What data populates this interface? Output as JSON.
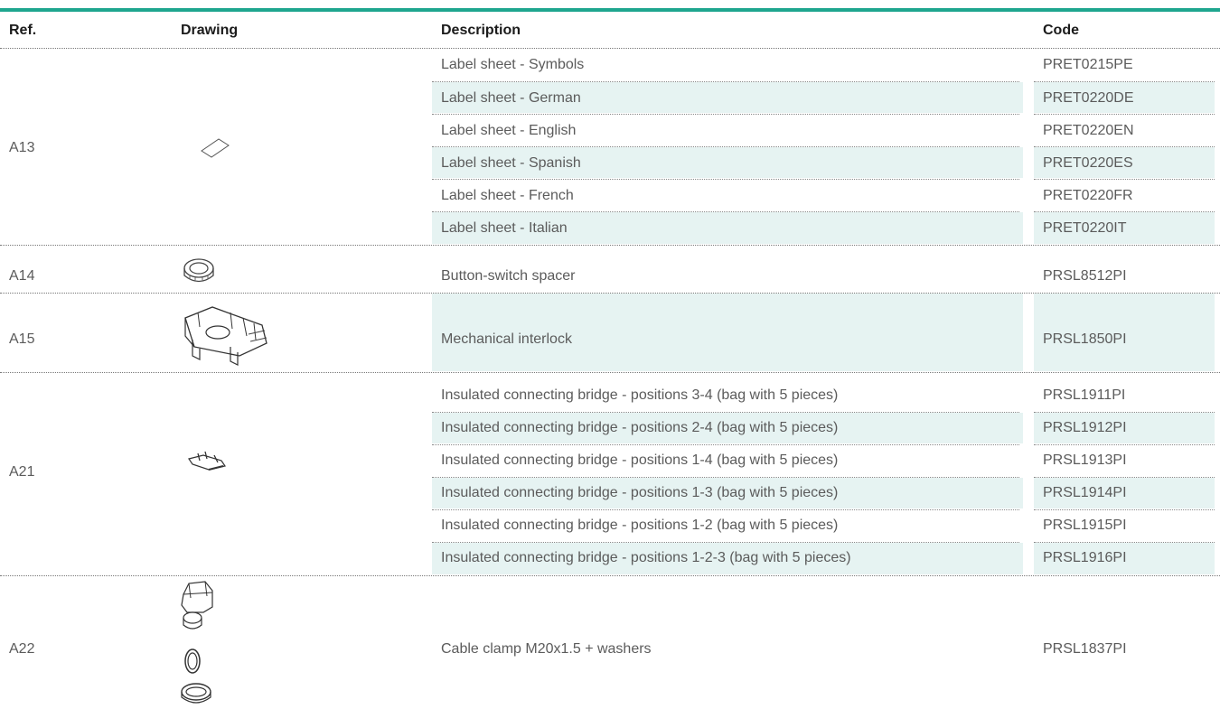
{
  "table": {
    "headers": [
      "Ref.",
      "Drawing",
      "Description",
      "Code"
    ],
    "groups": [
      {
        "ref": "A13",
        "drawing_icon": "label-sheet-icon",
        "rows": [
          {
            "description": "Label sheet - Symbols",
            "code": "PRET0215PE"
          },
          {
            "description": "Label sheet - German",
            "code": "PRET0220DE"
          },
          {
            "description": "Label sheet - English",
            "code": "PRET0220EN"
          },
          {
            "description": "Label sheet - Spanish",
            "code": "PRET0220ES"
          },
          {
            "description": "Label sheet - French",
            "code": "PRET0220FR"
          },
          {
            "description": "Label sheet - Italian",
            "code": "PRET0220IT"
          }
        ]
      },
      {
        "ref": "A14",
        "drawing_icon": "button-switch-spacer-icon",
        "rows": [
          {
            "description": "Button-switch spacer",
            "code": "PRSL8512PI"
          }
        ]
      },
      {
        "ref": "A15",
        "drawing_icon": "mechanical-interlock-icon",
        "rows": [
          {
            "description": "Mechanical interlock",
            "code": "PRSL1850PI"
          }
        ]
      },
      {
        "ref": "A21",
        "drawing_icon": "connecting-bridge-icon",
        "rows": [
          {
            "description": "Insulated connecting bridge - positions 3-4 (bag with 5 pieces)",
            "code": "PRSL1911PI"
          },
          {
            "description": "Insulated connecting bridge - positions 2-4 (bag with 5 pieces)",
            "code": "PRSL1912PI"
          },
          {
            "description": "Insulated connecting bridge - positions 1-4 (bag with 5 pieces)",
            "code": "PRSL1913PI"
          },
          {
            "description": "Insulated connecting bridge - positions 1-3 (bag with 5 pieces)",
            "code": "PRSL1914PI"
          },
          {
            "description": "Insulated connecting bridge - positions 1-2 (bag with 5 pieces)",
            "code": "PRSL1915PI"
          },
          {
            "description": "Insulated connecting bridge - positions 1-2-3 (bag with 5 pieces)",
            "code": "PRSL1916PI"
          }
        ]
      },
      {
        "ref": "A22",
        "drawing_icon": "cable-clamp-icon",
        "rows": [
          {
            "description": "Cable clamp M20x1.5 + washers",
            "code": "PRSL1837PI"
          }
        ]
      }
    ]
  },
  "colors": {
    "accent": "#1fa68f",
    "row_shade": "#e6f3f2",
    "header_text": "#1b1b1b",
    "body_text": "#5b5b5b"
  }
}
